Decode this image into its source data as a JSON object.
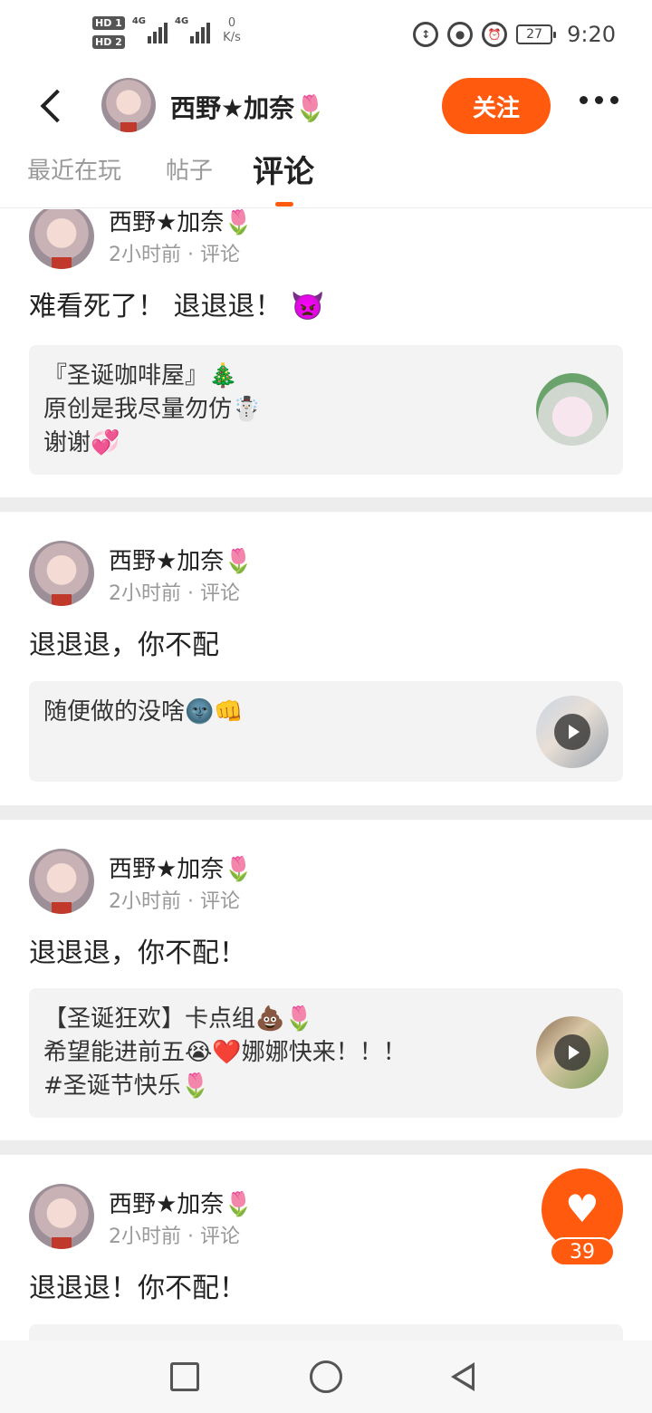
{
  "status_bar": {
    "hd1": "HD 1",
    "hd2": "HD 2",
    "sig1": "4G",
    "sig2": "4G",
    "net_speed": "0",
    "net_unit": "K/s",
    "battery": "27",
    "time": "9:20"
  },
  "header": {
    "username": "西野★加奈🌷",
    "follow_label": "关注"
  },
  "tabs": [
    {
      "label": "最近在玩",
      "active": false
    },
    {
      "label": "帖子",
      "active": false
    },
    {
      "label": "评论",
      "active": true
    }
  ],
  "posts": [
    {
      "author": "西野★加奈🌷",
      "time": "2小时前",
      "type": "评论",
      "text": "难看死了！ 退退退！ 👿",
      "card_lines": [
        "『圣诞咖啡屋』🎄",
        "原创是我尽量勿仿☃️",
        "谢谢💞"
      ],
      "thumb_icon": "christmas-thumbnail",
      "video": false
    },
    {
      "author": "西野★加奈🌷",
      "time": "2小时前",
      "type": "评论",
      "text": "退退退，你不配",
      "card_lines": [
        "随便做的没啥🌚👊"
      ],
      "thumb_icon": "video-thumbnail",
      "video": true
    },
    {
      "author": "西野★加奈🌷",
      "time": "2小时前",
      "type": "评论",
      "text": "退退退，你不配！",
      "card_lines": [
        "【圣诞狂欢】卡点组💩🌷",
        "希望能进前五😭❤️娜娜快来！！！",
        "#圣诞节快乐🌷"
      ],
      "thumb_icon": "video-thumbnail",
      "video": true
    },
    {
      "author": "西野★加奈🌷",
      "time": "2小时前",
      "type": "评论",
      "text": "退退退！你不配！",
      "card_lines": [],
      "thumb_icon": "",
      "video": false
    }
  ],
  "like": {
    "count": "39",
    "icon": "heart-icon"
  },
  "navbar": {
    "icons": [
      "recent-apps-icon",
      "home-icon",
      "back-icon"
    ]
  },
  "colors": {
    "accent": "#ff5a0e",
    "divider": "#ededed",
    "card_bg": "#f3f3f3",
    "muted_text": "#999999"
  }
}
